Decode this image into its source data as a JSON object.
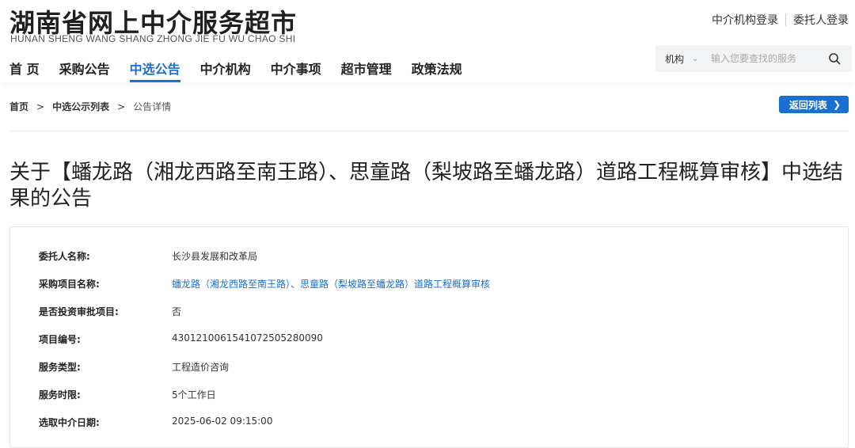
{
  "site": {
    "title": "湖南省网上中介服务超市",
    "subtitle": "HUNAN SHENG WANG SHANG ZHONG JIE FU WU CHAO SHI",
    "login_agency": "中介机构登录",
    "login_client": "委托人登录"
  },
  "nav": {
    "items": [
      {
        "label": "首 页"
      },
      {
        "label": "采购公告"
      },
      {
        "label": "中选公告",
        "active": true
      },
      {
        "label": "中介机构"
      },
      {
        "label": "中介事项"
      },
      {
        "label": "超市管理"
      },
      {
        "label": "政策法规"
      }
    ]
  },
  "search": {
    "selected": "机构",
    "placeholder": "输入您要查找的服务"
  },
  "breadcrumb": {
    "home": "首页",
    "list": "中选公示列表",
    "current": "公告详情",
    "separator": ">",
    "back_label": "返回列表"
  },
  "notice": {
    "title": "关于【蟠龙路（湘龙西路至南王路）、思童路（梨坡路至蟠龙路）道路工程概算审核】中选结果的公告"
  },
  "details": [
    {
      "label": "委托人名称:",
      "value": "长沙县发展和改革局"
    },
    {
      "label": "采购项目名称:",
      "value": "蟠龙路（湘龙西路至南王路）、思童路（梨坡路至蟠龙路）道路工程概算审核",
      "link": true
    },
    {
      "label": "是否投资审批项目:",
      "value": "否"
    },
    {
      "label": "项目编号:",
      "value": "430121006154107250528​0090"
    },
    {
      "label": "服务类型:",
      "value": "工程造价咨询"
    },
    {
      "label": "服务时限:",
      "value": "5个工作日"
    },
    {
      "label": "选取中介日期:",
      "value": "2025-06-02 09:15:00"
    }
  ],
  "colors": {
    "accent": "#1a6fd1"
  }
}
